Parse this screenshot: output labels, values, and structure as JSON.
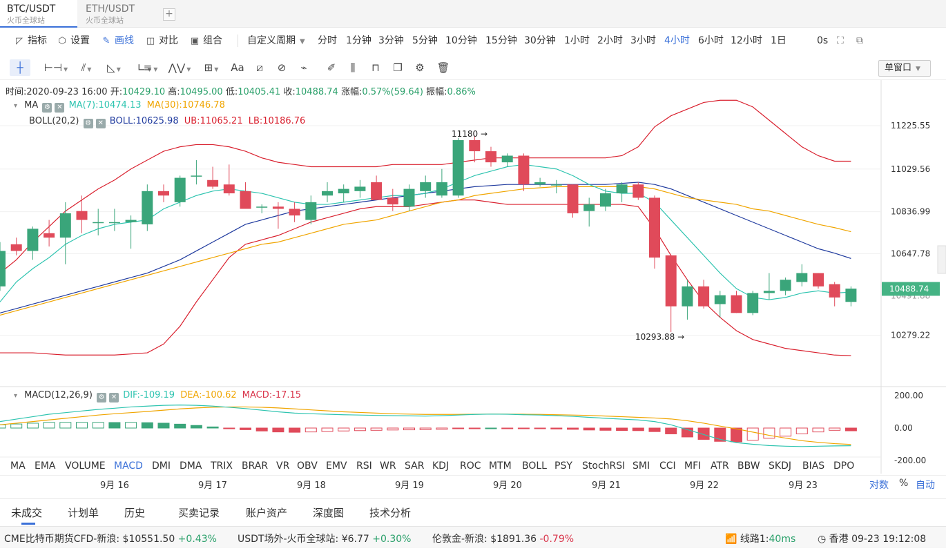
{
  "tabs": [
    {
      "pair": "BTC/USDT",
      "exchange": "火币全球站",
      "active": true
    },
    {
      "pair": "ETH/USDT",
      "exchange": "火币全球站",
      "active": false
    }
  ],
  "add_tab": "+",
  "toolbar": {
    "indicators": "指标",
    "settings": "设置",
    "draw": "画线",
    "compare": "对比",
    "combine": "组合",
    "custom_period": "自定义周期",
    "periods": [
      "分时",
      "1分钟",
      "3分钟",
      "5分钟",
      "10分钟",
      "15分钟",
      "30分钟",
      "1小时",
      "2小时",
      "3小时",
      "4小时",
      "6小时",
      "12小时",
      "1日"
    ],
    "active_period": "4小时",
    "latency": "0s",
    "window_mode": "单窗口"
  },
  "drawing_tools": [
    "crosshair-icon",
    "horizontal-line-icon",
    "trend-lines-icon",
    "angle-icon",
    "ruler-icon",
    "parallel-lines-icon",
    "wave-icon",
    "grid-icon",
    "text-icon",
    "fibonacci-icon",
    "brush-icon",
    "measure-icon",
    "pen-icon",
    "candle-pattern-icon",
    "lock-icon",
    "copy-icon",
    "settings-tool-icon",
    "trash-icon"
  ],
  "ohlc": {
    "time_label": "时间:",
    "time": "2020-09-23 16:00",
    "open_label": "开:",
    "open": "10429.10",
    "high_label": "高:",
    "high": "10495.00",
    "low_label": "低:",
    "low": "10405.41",
    "close_label": "收:",
    "close": "10488.74",
    "change_label": "涨幅:",
    "change": "0.57%(59.64)",
    "amp_label": "振幅:",
    "amplitude": "0.86%"
  },
  "ma": {
    "name": "MA",
    "ma7": "MA(7):10474.13",
    "ma30": "MA(30):10746.78"
  },
  "boll": {
    "name": "BOLL(20,2)",
    "mid": "BOLL:10625.98",
    "ub": "UB:11065.21",
    "lb": "LB:10186.76"
  },
  "macd": {
    "name": "MACD(12,26,9)",
    "dif": "DIF:-109.19",
    "dea": "DEA:-100.62",
    "macd": "MACD:-17.15"
  },
  "colors": {
    "up": "#3aa57a",
    "down": "#e04a5a",
    "ma7": "#2ec4b0",
    "ma30": "#f0a500",
    "boll_mid": "#1f3a9e",
    "boll_band": "#d9202e",
    "accent": "#3a70d8"
  },
  "chart_data": {
    "type": "candlestick",
    "price_axis": {
      "ticks": [
        11225.55,
        11029.56,
        10836.99,
        10647.78,
        10279.22
      ],
      "current_price": "10488.74",
      "behind_label": "10491.88"
    },
    "macd_axis": {
      "ticks": [
        "200.00",
        "0.00",
        "-200.00"
      ]
    },
    "annotations": {
      "high": "11180 →",
      "low": "10293.88 →"
    },
    "dates": [
      "9月 16",
      "9月 17",
      "9月 18",
      "9月 19",
      "9月 20",
      "9月 21",
      "9月 22",
      "9月 23"
    ],
    "candles": [
      [
        10500,
        10700,
        10480,
        10660
      ],
      [
        10690,
        10720,
        10640,
        10660
      ],
      [
        10660,
        10770,
        10620,
        10760
      ],
      [
        10740,
        10800,
        10680,
        10720
      ],
      [
        10720,
        10880,
        10600,
        10830
      ],
      [
        10840,
        10910,
        10740,
        10800
      ],
      [
        10790,
        10850,
        10730,
        10790
      ],
      [
        10790,
        10850,
        10750,
        10790
      ],
      [
        10790,
        10820,
        10670,
        10800
      ],
      [
        10780,
        10960,
        10750,
        10930
      ],
      [
        10930,
        10960,
        10880,
        10910
      ],
      [
        10880,
        11000,
        10860,
        10990
      ],
      [
        11000,
        11070,
        10960,
        11000
      ],
      [
        10980,
        11040,
        10940,
        10950
      ],
      [
        10960,
        11050,
        10910,
        10920
      ],
      [
        10930,
        10970,
        10850,
        10850
      ],
      [
        10860,
        10870,
        10830,
        10860
      ],
      [
        10860,
        10880,
        10760,
        10850
      ],
      [
        10850,
        10880,
        10790,
        10820
      ],
      [
        10800,
        10910,
        10780,
        10880
      ],
      [
        10910,
        10970,
        10880,
        10930
      ],
      [
        10920,
        10960,
        10880,
        10940
      ],
      [
        10930,
        10980,
        10900,
        10950
      ],
      [
        10970,
        11000,
        10890,
        10890
      ],
      [
        10900,
        10940,
        10840,
        10870
      ],
      [
        10860,
        10960,
        10840,
        10940
      ],
      [
        10930,
        11000,
        10900,
        10970
      ],
      [
        10910,
        11030,
        10900,
        10970
      ],
      [
        10910,
        11170,
        10900,
        11160
      ],
      [
        11160,
        11180,
        11060,
        11110
      ],
      [
        11110,
        11130,
        11040,
        11060
      ],
      [
        11060,
        11100,
        11040,
        11090
      ],
      [
        11090,
        11100,
        10930,
        10960
      ],
      [
        10960,
        10990,
        10950,
        10970
      ],
      [
        10960,
        10980,
        10920,
        10960
      ],
      [
        10960,
        10960,
        10810,
        10830
      ],
      [
        10840,
        10900,
        10770,
        10870
      ],
      [
        10860,
        10940,
        10840,
        10920
      ],
      [
        10920,
        10970,
        10880,
        10960
      ],
      [
        10960,
        10970,
        10890,
        10900
      ],
      [
        10900,
        10910,
        10580,
        10630
      ],
      [
        10640,
        10640,
        10294,
        10410
      ],
      [
        10410,
        10530,
        10350,
        10500
      ],
      [
        10500,
        10530,
        10400,
        10410
      ],
      [
        10420,
        10480,
        10360,
        10460
      ],
      [
        10460,
        10480,
        10380,
        10380
      ],
      [
        10380,
        10480,
        10370,
        10470
      ],
      [
        10470,
        10560,
        10440,
        10480
      ],
      [
        10480,
        10540,
        10460,
        10530
      ],
      [
        10520,
        10600,
        10500,
        10560
      ],
      [
        10560,
        10560,
        10490,
        10500
      ],
      [
        10510,
        10520,
        10410,
        10450
      ],
      [
        10430,
        10500,
        10410,
        10490
      ]
    ],
    "ma7": [
      10430,
      10520,
      10580,
      10630,
      10690,
      10730,
      10760,
      10780,
      10790,
      10800,
      10850,
      10880,
      10910,
      10930,
      10940,
      10930,
      10920,
      10900,
      10880,
      10870,
      10870,
      10880,
      10890,
      10900,
      10910,
      10910,
      10920,
      10940,
      10970,
      11000,
      11020,
      11040,
      11050,
      11040,
      11030,
      11000,
      10960,
      10930,
      10920,
      10920,
      10880,
      10800,
      10720,
      10640,
      10560,
      10490,
      10450,
      10440,
      10450,
      10470,
      10480,
      10470,
      10474
    ],
    "ma30": [
      10370,
      10390,
      10410,
      10430,
      10450,
      10470,
      10490,
      10510,
      10530,
      10550,
      10570,
      10590,
      10610,
      10630,
      10650,
      10670,
      10690,
      10700,
      10720,
      10740,
      10760,
      10780,
      10790,
      10800,
      10820,
      10840,
      10860,
      10880,
      10890,
      10910,
      10920,
      10930,
      10940,
      10945,
      10950,
      10950,
      10950,
      10950,
      10950,
      10950,
      10940,
      10920,
      10900,
      10890,
      10880,
      10870,
      10850,
      10840,
      10820,
      10800,
      10780,
      10765,
      10747
    ],
    "boll_mid": [
      10380,
      10400,
      10420,
      10440,
      10460,
      10480,
      10500,
      10520,
      10540,
      10560,
      10590,
      10620,
      10660,
      10700,
      10740,
      10780,
      10800,
      10820,
      10840,
      10850,
      10860,
      10870,
      10880,
      10890,
      10900,
      10910,
      10920,
      10930,
      10940,
      10950,
      10955,
      10960,
      10960,
      10960,
      10960,
      10960,
      10960,
      10960,
      10965,
      10970,
      10960,
      10940,
      10910,
      10880,
      10850,
      10820,
      10790,
      10760,
      10730,
      10700,
      10670,
      10650,
      10626
    ],
    "boll_ub": [
      10560,
      10620,
      10700,
      10770,
      10840,
      10890,
      10940,
      10980,
      11030,
      11070,
      11110,
      11130,
      11140,
      11140,
      11130,
      11110,
      11080,
      11060,
      11050,
      11040,
      11040,
      11040,
      11040,
      11040,
      11050,
      11050,
      11050,
      11050,
      11060,
      11070,
      11080,
      11080,
      11080,
      11080,
      11080,
      11080,
      11080,
      11080,
      11090,
      11130,
      11220,
      11270,
      11300,
      11330,
      11340,
      11340,
      11310,
      11250,
      11190,
      11130,
      11090,
      11065,
      11065
    ],
    "boll_lb": [
      10200,
      10200,
      10200,
      10195,
      10190,
      10190,
      10190,
      10190,
      10195,
      10200,
      10240,
      10320,
      10430,
      10530,
      10630,
      10690,
      10710,
      10730,
      10760,
      10790,
      10810,
      10830,
      10850,
      10860,
      10860,
      10860,
      10870,
      10880,
      10890,
      10890,
      10880,
      10870,
      10870,
      10870,
      10870,
      10870,
      10870,
      10870,
      10870,
      10860,
      10760,
      10640,
      10530,
      10430,
      10360,
      10300,
      10260,
      10240,
      10220,
      10210,
      10200,
      10190,
      10187
    ],
    "macd_dif": [
      40,
      55,
      70,
      85,
      95,
      105,
      115,
      122,
      130,
      135,
      140,
      142,
      140,
      135,
      128,
      120,
      110,
      100,
      92,
      88,
      85,
      82,
      80,
      78,
      76,
      75,
      74,
      76,
      80,
      84,
      86,
      85,
      82,
      80,
      76,
      72,
      66,
      60,
      55,
      50,
      40,
      20,
      -10,
      -40,
      -70,
      -90,
      -100,
      -108,
      -112,
      -114,
      -112,
      -110,
      -109
    ],
    "macd_dea": [
      20,
      30,
      40,
      50,
      60,
      70,
      80,
      88,
      95,
      102,
      110,
      118,
      124,
      128,
      130,
      130,
      128,
      124,
      118,
      112,
      106,
      100,
      96,
      92,
      88,
      86,
      84,
      84,
      84,
      85,
      86,
      86,
      85,
      84,
      82,
      80,
      78,
      74,
      70,
      66,
      62,
      56,
      45,
      30,
      12,
      -5,
      -25,
      -45,
      -62,
      -78,
      -88,
      -96,
      -101
    ],
    "macd_hist": [
      20,
      25,
      30,
      35,
      35,
      35,
      35,
      34,
      35,
      33,
      30,
      24,
      16,
      7,
      -2,
      -10,
      -18,
      -24,
      -26,
      -24,
      -21,
      -18,
      -16,
      -14,
      -12,
      -11,
      -10,
      -8,
      -4,
      -1,
      0,
      -1,
      -3,
      -4,
      -6,
      -8,
      -12,
      -14,
      -15,
      -16,
      -22,
      -36,
      -55,
      -70,
      -82,
      -85,
      -75,
      -63,
      -50,
      -36,
      -24,
      -14,
      -17
    ]
  },
  "indicator_tabs": [
    "MA",
    "EMA",
    "VOLUME",
    "MACD",
    "DMI",
    "DMA",
    "TRIX",
    "BRAR",
    "VR",
    "OBV",
    "EMV",
    "RSI",
    "WR",
    "SAR",
    "KDJ",
    "ROC",
    "MTM",
    "BOLL",
    "PSY",
    "StochRSI",
    "SMI",
    "CCI",
    "MFI",
    "ATR",
    "BBW",
    "SKDJ",
    "BIAS",
    "DPO"
  ],
  "active_indicator": "MACD",
  "scale": {
    "log": "对数",
    "percent": "%",
    "auto": "自动"
  },
  "panel_tabs": [
    "未成交",
    "计划单",
    "历史",
    "买卖记录",
    "账户资产",
    "深度图",
    "技术分析"
  ],
  "status_bar": {
    "cme_label": "CME比特币期货CFD-新浪:",
    "cme_price": "$10551.50",
    "cme_change": "+0.43%",
    "usdt_label": "USDT场外-火币全球站:",
    "usdt_price": "¥6.77",
    "usdt_change": "+0.30%",
    "gold_label": "伦敦金-新浪:",
    "gold_price": "$1891.36",
    "gold_change": "-0.79%",
    "line_label": "线路1:",
    "line_latency": "40ms",
    "clock_label": "香港 09-23 19:12:08"
  }
}
